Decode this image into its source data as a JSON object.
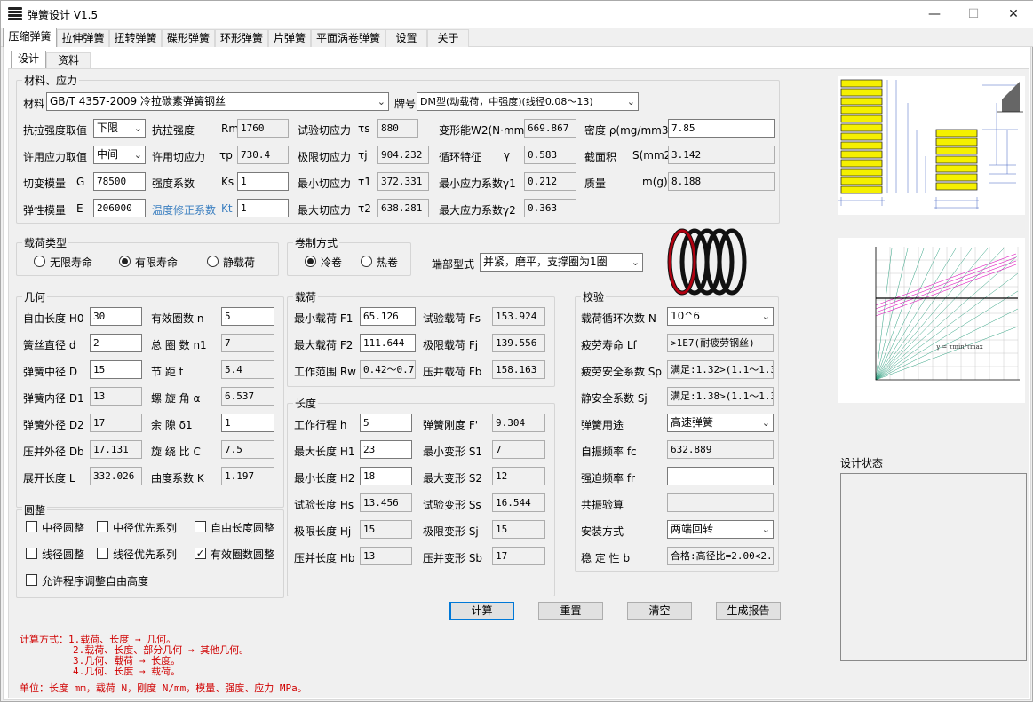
{
  "app": {
    "title": "弹簧设计  V1.5"
  },
  "main_tabs": [
    "压缩弹簧",
    "拉伸弹簧",
    "扭转弹簧",
    "碟形弹簧",
    "环形弹簧",
    "片弹簧",
    "平面涡卷弹簧",
    "设置",
    "关于"
  ],
  "sub_tabs": [
    "设计",
    "资料"
  ],
  "material": {
    "group_title": "材料、应力",
    "material_label": "材料",
    "material_value": "GB/T  4357-2009 冷拉碳素弹簧钢丝",
    "grade_label": "牌号",
    "grade_value": "DM型(动载荷，中强度)(线径0.08～13)",
    "rows": [
      {
        "a_label": "抗拉强度取值",
        "a_select": "下限",
        "b_label": "抗拉强度",
        "b_sym": "Rm",
        "b_val": "1760",
        "c_label": "试验切应力",
        "c_sym": "τs",
        "c_val": "880",
        "d_label": "变形能W2(N·mm)",
        "d_val": "669.867",
        "e_label": "密度 ρ(mg/mm3)",
        "e_val": "7.85"
      },
      {
        "a_label": "许用应力取值",
        "a_select": "中间",
        "b_label": "许用切应力",
        "b_sym": "τp",
        "b_val": "730.4",
        "c_label": "极限切应力",
        "c_sym": "τj",
        "c_val": "904.232",
        "d_label": "循环特征",
        "d_sym": "γ",
        "d_val": "0.583",
        "e_label": "截面积",
        "e_sym": "S(mm2)",
        "e_val": "3.142"
      },
      {
        "a_label": "切变模量",
        "a_sym": "G",
        "a_val": "78500",
        "b_label": "强度系数",
        "b_sym": "Ks",
        "b_val": "1",
        "c_label": "最小切应力",
        "c_sym": "τ1",
        "c_val": "372.331",
        "d_label": "最小应力系数γ1",
        "d_val": "0.212",
        "e_label": "质量",
        "e_sym": "m(g)",
        "e_val": "8.188"
      },
      {
        "a_label": "弹性模量",
        "a_sym": "E",
        "a_val": "206000",
        "b_label": "温度修正系数",
        "b_sym": "Kt",
        "b_val": "1",
        "c_label": "最大切应力",
        "c_sym": "τ2",
        "c_val": "638.281",
        "d_label": "最大应力系数γ2",
        "d_val": "0.363"
      }
    ]
  },
  "load_type": {
    "title": "载荷类型",
    "options": [
      "无限寿命",
      "有限寿命",
      "静载荷"
    ],
    "selected": 1
  },
  "coil_method": {
    "title": "卷制方式",
    "options": [
      "冷卷",
      "热卷"
    ],
    "selected": 0
  },
  "end_type": {
    "label": "端部型式",
    "value": "并紧，磨平，支撑圈为1圈"
  },
  "geometry": {
    "title": "几何",
    "rows": [
      {
        "l1": "自由长度 H0",
        "v1": "30",
        "l2": "有效圈数  n",
        "v2": "5"
      },
      {
        "l1": "簧丝直径 d",
        "v1": "2",
        "l2": "总 圈 数  n1",
        "v2": "7"
      },
      {
        "l1": "弹簧中径 D",
        "v1": "15",
        "l2": "节    距  t",
        "v2": "5.4"
      },
      {
        "l1": "弹簧内径 D1",
        "v1": "13",
        "l2": "螺 旋 角  α",
        "v2": "6.537"
      },
      {
        "l1": "弹簧外径 D2",
        "v1": "17",
        "l2": "余    隙 δ1",
        "v2": "1"
      },
      {
        "l1": "压并外径 Db",
        "v1": "17.131",
        "l2": "旋 绕 比  C",
        "v2": "7.5"
      },
      {
        "l1": "展开长度 L",
        "v1": "332.026",
        "l2": "曲度系数  K",
        "v2": "1.197"
      }
    ]
  },
  "rounding": {
    "title": "圆整",
    "items": [
      {
        "label": "中径圆整",
        "checked": false
      },
      {
        "label": "中径优先系列",
        "checked": false
      },
      {
        "label": "自由长度圆整",
        "checked": false
      },
      {
        "label": "线径圆整",
        "checked": false
      },
      {
        "label": "线径优先系列",
        "checked": false
      },
      {
        "label": "有效圈数圆整",
        "checked": true
      },
      {
        "label": "允许程序调整自由高度",
        "checked": false
      }
    ]
  },
  "load": {
    "title": "载荷",
    "rows": [
      {
        "l1": "最小载荷 F1",
        "v1": "65.126",
        "l2": "试验载荷  Fs",
        "v2": "153.924"
      },
      {
        "l1": "最大载荷 F2",
        "v1": "111.644",
        "l2": "极限载荷  Fj",
        "v2": "139.556"
      },
      {
        "l1": "工作范围 Rw",
        "v1": "0.42～0.73",
        "l2": "压并载荷  Fb",
        "v2": "158.163"
      }
    ]
  },
  "length": {
    "title": "长度",
    "rows": [
      {
        "l1": "工作行程 h",
        "v1": "5",
        "l2": "弹簧刚度  F'",
        "v2": "9.304"
      },
      {
        "l1": "最大长度 H1",
        "v1": "23",
        "l2": "最小变形  S1",
        "v2": "7"
      },
      {
        "l1": "最小长度 H2",
        "v1": "18",
        "l2": "最大变形  S2",
        "v2": "12"
      },
      {
        "l1": "试验长度 Hs",
        "v1": "13.456",
        "l2": "试验变形  Ss",
        "v2": "16.544"
      },
      {
        "l1": "极限长度 Hj",
        "v1": "15",
        "l2": "极限变形  Sj",
        "v2": "15"
      },
      {
        "l1": "压并长度 Hb",
        "v1": "13",
        "l2": "压并变形  Sb",
        "v2": "17"
      }
    ]
  },
  "check": {
    "title": "校验",
    "rows": [
      {
        "label": "载荷循环次数 N",
        "value": "10^6",
        "type": "select"
      },
      {
        "label": "疲劳寿命    Lf",
        "value": ">1E7(耐疲劳钢丝)",
        "type": "ro"
      },
      {
        "label": "疲劳安全系数 Sp",
        "value": "满足:1.32>(1.1～1.3",
        "type": "ro"
      },
      {
        "label": "静安全系数  Sj",
        "value": "满足:1.38>(1.1～1.3",
        "type": "ro"
      },
      {
        "label": "弹簧用途",
        "value": "高速弹簧",
        "type": "select"
      },
      {
        "label": "自振频率    fc",
        "value": "632.889",
        "type": "ro"
      },
      {
        "label": "强迫频率    fr",
        "value": "",
        "type": "input"
      },
      {
        "label": "共振验算",
        "value": "",
        "type": "ro"
      },
      {
        "label": "安装方式",
        "value": "两端回转",
        "type": "select"
      },
      {
        "label": "稳 定 性    b",
        "value": "合格:高径比=2.00<2.",
        "type": "ro"
      }
    ]
  },
  "buttons": {
    "calc": "计算",
    "reset": "重置",
    "clear": "清空",
    "report": "生成报告"
  },
  "notes": {
    "lines": [
      "计算方式：1.载荷、长度 → 几何。",
      "2.载荷、长度、部分几何 → 其他几何。",
      "3.几何、载荷 → 长度。",
      "4.几何、长度 → 载荷。"
    ],
    "units": "单位：长度 mm，载荷 N，刚度 N/mm，模量、强度、应力 MPa。"
  },
  "design_status": {
    "title": "设计状态"
  },
  "colors": {
    "spring_yellow": "#f5f000",
    "chart_green": "#30a080",
    "chart_pink": "#e020c0"
  }
}
